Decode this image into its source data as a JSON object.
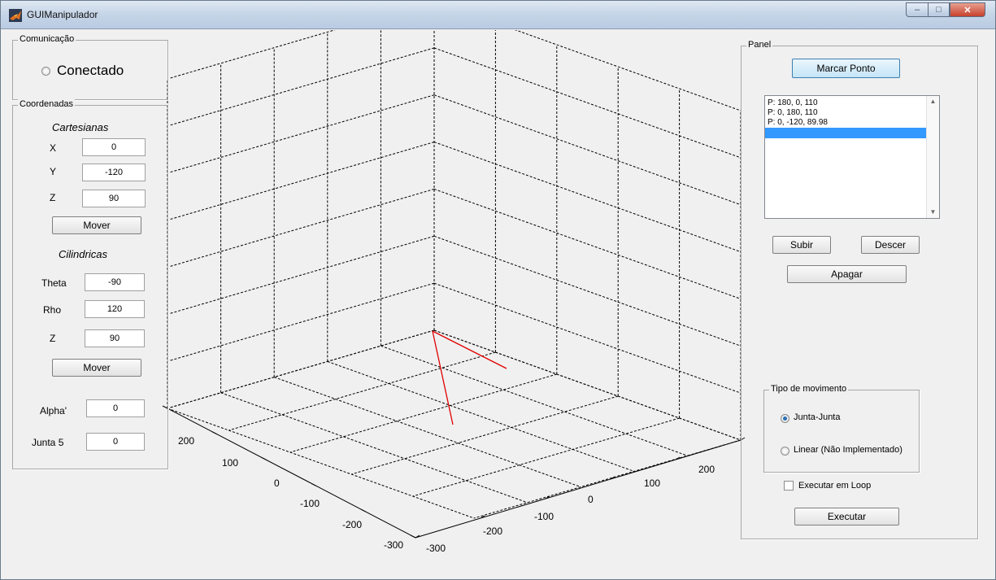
{
  "window": {
    "title": "GUIManipulador"
  },
  "comunicacao": {
    "title": "Comunicação",
    "status_label": "Conectado"
  },
  "coordenadas": {
    "title": "Coordenadas",
    "cartesianas": {
      "heading": "Cartesianas",
      "x_label": "X",
      "x_value": "0",
      "y_label": "Y",
      "y_value": "-120",
      "z_label": "Z",
      "z_value": "90",
      "move_label": "Mover"
    },
    "cilindricas": {
      "heading": "Cilindricas",
      "theta_label": "Theta",
      "theta_value": "-90",
      "rho_label": "Rho",
      "rho_value": "120",
      "z_label": "Z",
      "z_value": "90",
      "move_label": "Mover"
    },
    "alpha_label": "Alpha'",
    "alpha_value": "0",
    "junta5_label": "Junta 5",
    "junta5_value": "0"
  },
  "plot": {
    "line_color": "#e00000",
    "x_ticks": [
      "200",
      "100",
      "0",
      "-100",
      "-200",
      "-300"
    ],
    "y_ticks": [
      "-300",
      "-200",
      "-100",
      "0",
      "100",
      "200"
    ]
  },
  "panel": {
    "title": "Panel",
    "marcar_ponto_label": "Marcar Ponto",
    "points": [
      "P:  180,  0,  110",
      "P:  0,  180,  110",
      "P:  0,  -120,  89.98",
      ""
    ],
    "selected_index": 3,
    "subir_label": "Subir",
    "descer_label": "Descer",
    "apagar_label": "Apagar",
    "tipo_movimento": {
      "title": "Tipo de movimento",
      "options": [
        {
          "label": "Junta-Junta",
          "selected": true
        },
        {
          "label": "Linear (Não Implementado)",
          "selected": false
        }
      ]
    },
    "loop_label": "Executar em Loop",
    "loop_checked": false,
    "executar_label": "Executar"
  }
}
